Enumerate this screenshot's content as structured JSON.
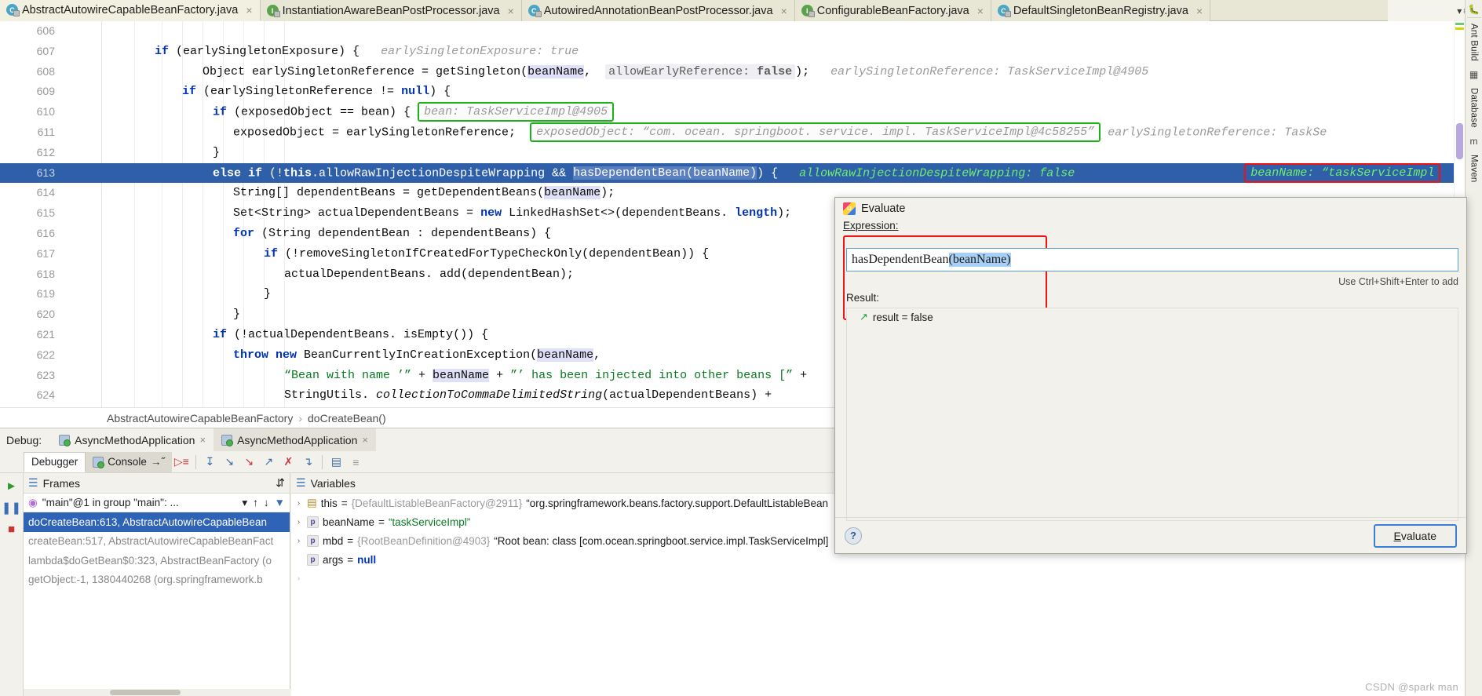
{
  "tabs": [
    {
      "label": "AbstractAutowireCapableBeanFactory.java",
      "icon": "class-icon",
      "kind": "class",
      "active": true
    },
    {
      "label": "InstantiationAwareBeanPostProcessor.java",
      "icon": "interface-icon",
      "kind": "interface",
      "active": false
    },
    {
      "label": "AutowiredAnnotationBeanPostProcessor.java",
      "icon": "class-icon",
      "kind": "class",
      "active": false
    },
    {
      "label": "ConfigurableBeanFactory.java",
      "icon": "interface-icon",
      "kind": "interface",
      "active": false
    },
    {
      "label": "DefaultSingletonBeanRegistry.java",
      "icon": "class-icon",
      "kind": "class",
      "active": false
    }
  ],
  "tabbar": {
    "overflow_count": "5",
    "close_glyph": "×",
    "list_glyph": "≡",
    "chevron": "▾"
  },
  "right_strip": {
    "items": [
      "Ant Build",
      "Database",
      "Maven"
    ],
    "bug_icon": "bug-icon"
  },
  "editor": {
    "first_line_number": 606,
    "lines": [
      {
        "num": "606",
        "segments": [],
        "state": "normal"
      },
      {
        "num": "607",
        "indent": 6,
        "state": "normal",
        "segments": [
          {
            "t": "if",
            "c": "kw"
          },
          {
            "t": " (earlySingletonExposure) {   ",
            "c": "plain"
          },
          {
            "t": "earlySingletonExposure: true",
            "c": "hint"
          }
        ]
      },
      {
        "num": "608",
        "indent": 8,
        "state": "normal",
        "segments": [
          {
            "t": "Object earlySingletonReference = getSingleton(",
            "c": "plain"
          },
          {
            "t": "beanName",
            "c": "hl"
          },
          {
            "t": ",  ",
            "c": "plain"
          },
          {
            "t": "allowEarlyReference:",
            "c": "hintbg"
          },
          {
            "t": " false",
            "c": "hintbg-kw"
          },
          {
            "t": ");   ",
            "c": "plain"
          },
          {
            "t": "earlySingletonReference: TaskServiceImpl@4905",
            "c": "hint"
          }
        ]
      },
      {
        "num": "609",
        "indent": 7,
        "state": "normal",
        "segments": [
          {
            "t": "if",
            "c": "kw"
          },
          {
            "t": " (earlySingletonReference != ",
            "c": "plain"
          },
          {
            "t": "null",
            "c": "kw"
          },
          {
            "t": ") {",
            "c": "plain"
          }
        ]
      },
      {
        "num": "610",
        "indent": 9,
        "state": "normal",
        "segments": [
          {
            "t": "if",
            "c": "kw"
          },
          {
            "t": " (exposedObject == bean) {  ",
            "c": "plain"
          },
          {
            "t": "bean: TaskServiceImpl@4905",
            "c": "greenbox"
          }
        ]
      },
      {
        "num": "611",
        "indent": 11,
        "state": "normal",
        "segments": [
          {
            "t": "exposedObject = earlySingletonReference;  ",
            "c": "plain"
          },
          {
            "t": "exposedObject: “com. ocean. springboot. service. impl. TaskServiceImpl@4c58255”",
            "c": "greenbox"
          },
          {
            "t": "  earlySingletonReference: TaskSe",
            "c": "hint"
          }
        ]
      },
      {
        "num": "612",
        "indent": 9,
        "state": "normal",
        "segments": [
          {
            "t": "}",
            "c": "plain"
          }
        ]
      },
      {
        "num": "613",
        "indent": 9,
        "state": "executing",
        "segments": [
          {
            "t": "else if",
            "c": "kw"
          },
          {
            "t": " (!",
            "c": "plain"
          },
          {
            "t": "this",
            "c": "kw"
          },
          {
            "t": ".allowRawInjectionDespiteWrapping && ",
            "c": "plain"
          },
          {
            "t": "hasDependentBean(beanName)",
            "c": "hl"
          },
          {
            "t": ") {   ",
            "c": "plain"
          },
          {
            "t": "allowRawInjectionDespiteWrapping: false",
            "c": "hint"
          },
          {
            "t": "   ",
            "c": "plain"
          },
          {
            "t": "beanName: “taskServiceImpl",
            "c": "redbox"
          }
        ]
      },
      {
        "num": "614",
        "indent": 11,
        "state": "normal",
        "segments": [
          {
            "t": "String[] dependentBeans = getDependentBeans(",
            "c": "plain"
          },
          {
            "t": "beanName",
            "c": "hl"
          },
          {
            "t": ");",
            "c": "plain"
          }
        ]
      },
      {
        "num": "615",
        "indent": 11,
        "state": "normal",
        "segments": [
          {
            "t": "Set<String> actualDependentBeans = ",
            "c": "plain"
          },
          {
            "t": "new",
            "c": "kw"
          },
          {
            "t": " LinkedHashSet<>(dependentBeans. ",
            "c": "plain"
          },
          {
            "t": "length",
            "c": "kw"
          },
          {
            "t": ");",
            "c": "plain"
          }
        ]
      },
      {
        "num": "616",
        "indent": 11,
        "state": "normal",
        "segments": [
          {
            "t": "for",
            "c": "kw"
          },
          {
            "t": " (String dependentBean : dependentBeans) {",
            "c": "plain"
          }
        ]
      },
      {
        "num": "617",
        "indent": 12,
        "state": "normal",
        "segments": [
          {
            "t": "if",
            "c": "kw"
          },
          {
            "t": " (!removeSingletonIfCreatedForTypeCheckOnly(dependentBean)) {",
            "c": "plain"
          }
        ]
      },
      {
        "num": "618",
        "indent": 14,
        "state": "normal",
        "segments": [
          {
            "t": "actualDependentBeans. add(dependentBean);",
            "c": "plain"
          }
        ]
      },
      {
        "num": "619",
        "indent": 12,
        "state": "normal",
        "segments": [
          {
            "t": "}",
            "c": "plain"
          }
        ]
      },
      {
        "num": "620",
        "indent": 11,
        "state": "normal",
        "segments": [
          {
            "t": "}",
            "c": "plain"
          }
        ]
      },
      {
        "num": "621",
        "indent": 10,
        "state": "normal",
        "segments": [
          {
            "t": "if",
            "c": "kw"
          },
          {
            "t": " (!actualDependentBeans. isEmpty()) {",
            "c": "plain"
          }
        ]
      },
      {
        "num": "622",
        "indent": 12,
        "state": "normal",
        "segments": [
          {
            "t": "throw",
            "c": "kw"
          },
          {
            "t": " ",
            "c": "plain"
          },
          {
            "t": "new",
            "c": "kw"
          },
          {
            "t": " BeanCurrentlyInCreationException(",
            "c": "plain"
          },
          {
            "t": "beanName",
            "c": "hl"
          },
          {
            "t": ",",
            "c": "plain"
          }
        ]
      },
      {
        "num": "623",
        "indent": 14,
        "state": "normal",
        "segments": [
          {
            "t": "“Bean with name ’”",
            "c": "str"
          },
          {
            "t": " + ",
            "c": "plain"
          },
          {
            "t": "beanName",
            "c": "hl"
          },
          {
            "t": " + ",
            "c": "plain"
          },
          {
            "t": "”’ has been injected into other beans [”",
            "c": "str"
          },
          {
            "t": " +",
            "c": "plain"
          }
        ]
      },
      {
        "num": "624",
        "indent": 14,
        "state": "normal",
        "segments": [
          {
            "t": "StringUtils. ",
            "c": "plain"
          },
          {
            "t": "collectionToCommaDelimitedString",
            "c": "italic"
          },
          {
            "t": "(actualDependentBeans) +",
            "c": "plain"
          }
        ]
      }
    ]
  },
  "breadcrumb": {
    "class": "AbstractAutowireCapableBeanFactory",
    "separator": "›",
    "method": "doCreateBean()"
  },
  "debug": {
    "label": "Debug:",
    "sessions": [
      {
        "label": "AsyncMethodApplication",
        "active": false
      },
      {
        "label": "AsyncMethodApplication",
        "active": true
      }
    ],
    "subtabs": [
      {
        "label": "Debugger",
        "active": true,
        "icon": "debugger-icon"
      },
      {
        "label": "Console",
        "active": false,
        "icon": "console-icon",
        "suffix": "→˝"
      }
    ],
    "toolbar_icons": [
      "show-execution-point-icon",
      "step-over-icon",
      "step-into-icon",
      "force-step-into-icon",
      "step-out-icon",
      "drop-frame-icon",
      "run-to-cursor-icon",
      "evaluate-expression-icon",
      "mute-breakpoints-icon"
    ],
    "left_run_icons": [
      "resume-program-icon",
      "pause-program-icon",
      "stop-icon"
    ],
    "frames": {
      "title": "Frames",
      "pin_glyph": "⇵",
      "thread": "\"main\"@1 in group \"main\": ...",
      "thread_arrows": [
        "↑",
        "↓",
        "▼"
      ],
      "rows": [
        {
          "text": "doCreateBean:613, AbstractAutowireCapableBean",
          "selected": true
        },
        {
          "text": "createBean:517, AbstractAutowireCapableBeanFact",
          "selected": false
        },
        {
          "text": "lambda$doGetBean$0:323, AbstractBeanFactory (o",
          "selected": false
        },
        {
          "text": "getObject:-1, 1380440268 (org.springframework.b",
          "selected": false
        }
      ]
    },
    "variables": {
      "title": "Variables",
      "rows": [
        {
          "expand": "›",
          "badge": "",
          "name": "this",
          "eq": "=",
          "type": "{DefaultListableBeanFactory@2911}",
          "value": "“org.springframework.beans.factory.support.DefaultListableBean",
          "kind": "obj"
        },
        {
          "expand": "›",
          "badge": "p",
          "name": "beanName",
          "eq": "=",
          "type": "",
          "value": "“taskServiceImpl”",
          "kind": "str"
        },
        {
          "expand": "›",
          "badge": "p",
          "name": "mbd",
          "eq": "=",
          "type": "{RootBeanDefinition@4903}",
          "value": "“Root bean: class [com.ocean.springboot.service.impl.TaskServiceImpl]",
          "kind": "obj"
        },
        {
          "expand": "",
          "badge": "p",
          "name": "args",
          "eq": "=",
          "type": "",
          "value": "null",
          "kind": "null"
        }
      ]
    }
  },
  "evaluate_dialog": {
    "title": "Evaluate",
    "icon": "intellij-icon",
    "expression_label": "Expression:",
    "expression_value_plain": "hasDependentBean",
    "expression_value_selected": "(beanName)",
    "shortcut_hint": "Use Ctrl+Shift+Enter to add",
    "result_label": "Result:",
    "result_icon": "result-value-icon",
    "result_text": "result = false",
    "help_glyph": "?",
    "evaluate_button": "Evaluate",
    "evaluate_button_mnemonic": "E"
  },
  "watermark": "CSDN @spark man",
  "colors": {
    "tab_bar_bg": "#e8e6d4",
    "active_tab_bg": "#f2f0e0",
    "exec_line_bg": "#2f5fa8",
    "current_line_bg": "#fffae6",
    "green_box": "#19b319",
    "red_box": "#f01010",
    "selection_blue": "#a8d0f5",
    "frame_selected": "#2f63b5",
    "accent_button_border": "#3a7fd5"
  }
}
